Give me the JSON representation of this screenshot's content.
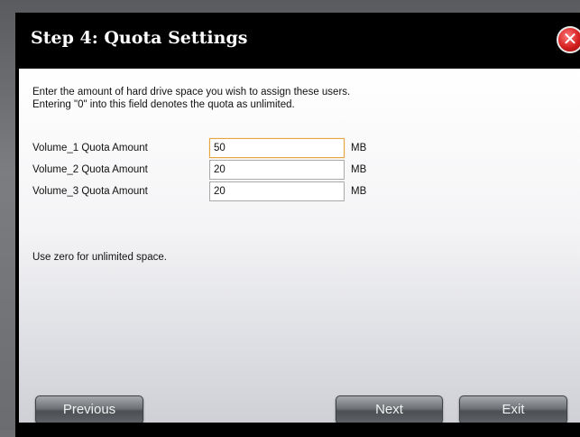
{
  "dialog": {
    "title": "Step 4: Quota Settings",
    "close_icon": "close-icon"
  },
  "intro": {
    "line1": "Enter the amount of hard drive space you wish to assign these users.",
    "line2": "Entering \"0\" into this field denotes the quota as unlimited."
  },
  "quotas": [
    {
      "label": "Volume_1 Quota Amount",
      "value": "50",
      "unit": "MB",
      "focused": true
    },
    {
      "label": "Volume_2 Quota Amount",
      "value": "20",
      "unit": "MB",
      "focused": false
    },
    {
      "label": "Volume_3 Quota Amount",
      "value": "20",
      "unit": "MB",
      "focused": false
    }
  ],
  "hint": "Use zero for unlimited space.",
  "buttons": {
    "previous": "Previous",
    "next": "Next",
    "exit": "Exit"
  },
  "colors": {
    "titlebar": "#000000",
    "focus_border": "#e5a640",
    "close_red": "#d41f1f"
  }
}
